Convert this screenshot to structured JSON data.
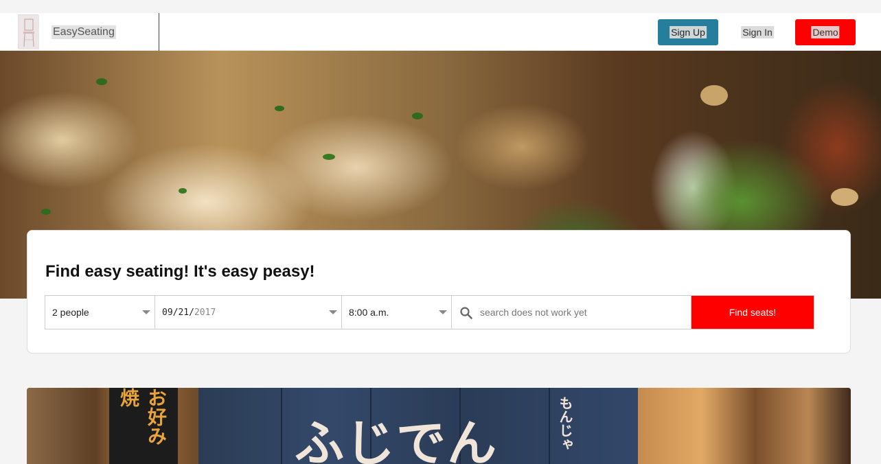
{
  "navbar": {
    "brand": "EasySeating",
    "sign_up": "Sign Up",
    "sign_in": "Sign In",
    "demo": "Demo"
  },
  "search": {
    "headline": "Find easy seating! It's easy peasy!",
    "party_size": "2 people",
    "date_md": "09/21/",
    "date_year": "2017",
    "time": "8:00 a.m.",
    "placeholder": "search does not work yet",
    "submit": "Find seats!"
  },
  "banner": {
    "sign_text": "ふじでん",
    "left_text": "お好み焼",
    "right_text": "もんじゃ"
  },
  "colors": {
    "primary_blue": "#257f9c",
    "accent_red": "#ff0000"
  }
}
